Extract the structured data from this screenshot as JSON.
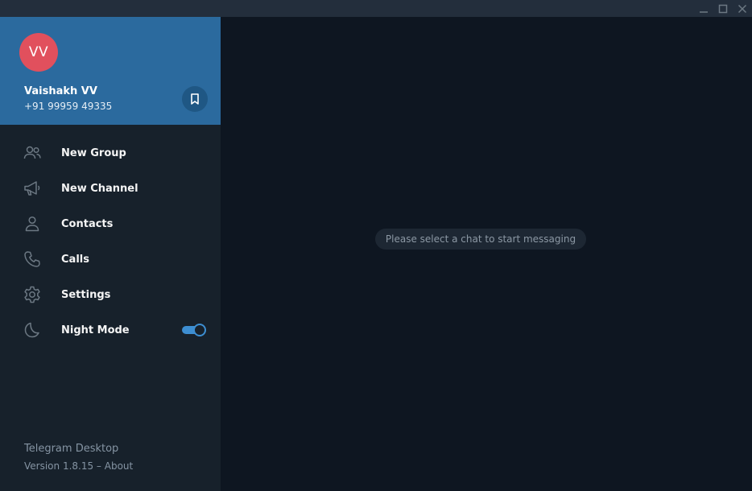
{
  "window": {
    "controls": [
      "minimize-icon",
      "maximize-icon",
      "close-icon"
    ]
  },
  "profile": {
    "initials": "VV",
    "name": "Vaishakh VV",
    "phone": "+91 99959 49335",
    "saved_icon": "bookmark-icon",
    "avatar_color": "#e1505d",
    "header_color": "#2b6a9e"
  },
  "menu": {
    "items": [
      {
        "label": "New Group",
        "icon": "group-icon"
      },
      {
        "label": "New Channel",
        "icon": "megaphone-icon"
      },
      {
        "label": "Contacts",
        "icon": "person-icon"
      },
      {
        "label": "Calls",
        "icon": "phone-icon"
      },
      {
        "label": "Settings",
        "icon": "gear-icon"
      },
      {
        "label": "Night Mode",
        "icon": "moon-icon",
        "toggle_on": true
      }
    ]
  },
  "footer": {
    "app_name": "Telegram Desktop",
    "version": "Version 1.8.15 – About"
  },
  "main": {
    "placeholder": "Please select a chat to start messaging"
  },
  "colors": {
    "sidebar_bg": "#17212b",
    "main_bg": "#0e1621",
    "accent": "#3d8ed1"
  }
}
